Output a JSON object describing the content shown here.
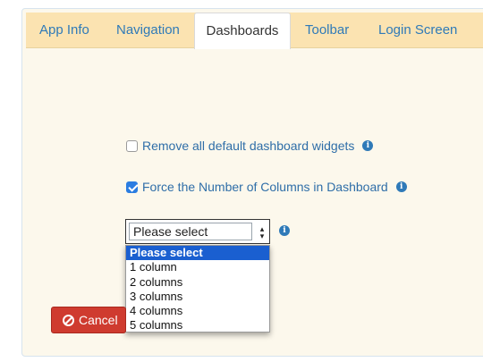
{
  "tabs": [
    {
      "label": "App Info"
    },
    {
      "label": "Navigation"
    },
    {
      "label": "Dashboards",
      "active": true
    },
    {
      "label": "Toolbar"
    },
    {
      "label": "Login Screen"
    }
  ],
  "options": {
    "remove_widgets": {
      "label": "Remove all default dashboard widgets",
      "checked": false
    },
    "force_columns": {
      "label": "Force the Number of Columns in Dashboard",
      "checked": true
    }
  },
  "columns_select": {
    "value": "Please select",
    "items": [
      "Please select",
      "1 column",
      "2 columns",
      "3 columns",
      "4 columns",
      "5 columns"
    ],
    "highlighted": "Please select"
  },
  "actions": {
    "cancel_label": "Cancel"
  },
  "colors": {
    "link": "#2f7ab8",
    "tab_bar": "#fbe3b1",
    "cancel": "#cf3b2f",
    "highlight": "#1a5fd0"
  },
  "icons": {
    "info": "info-circle-icon",
    "cancel": "ban-icon",
    "select_arrow": "chevron-updown-icon"
  }
}
